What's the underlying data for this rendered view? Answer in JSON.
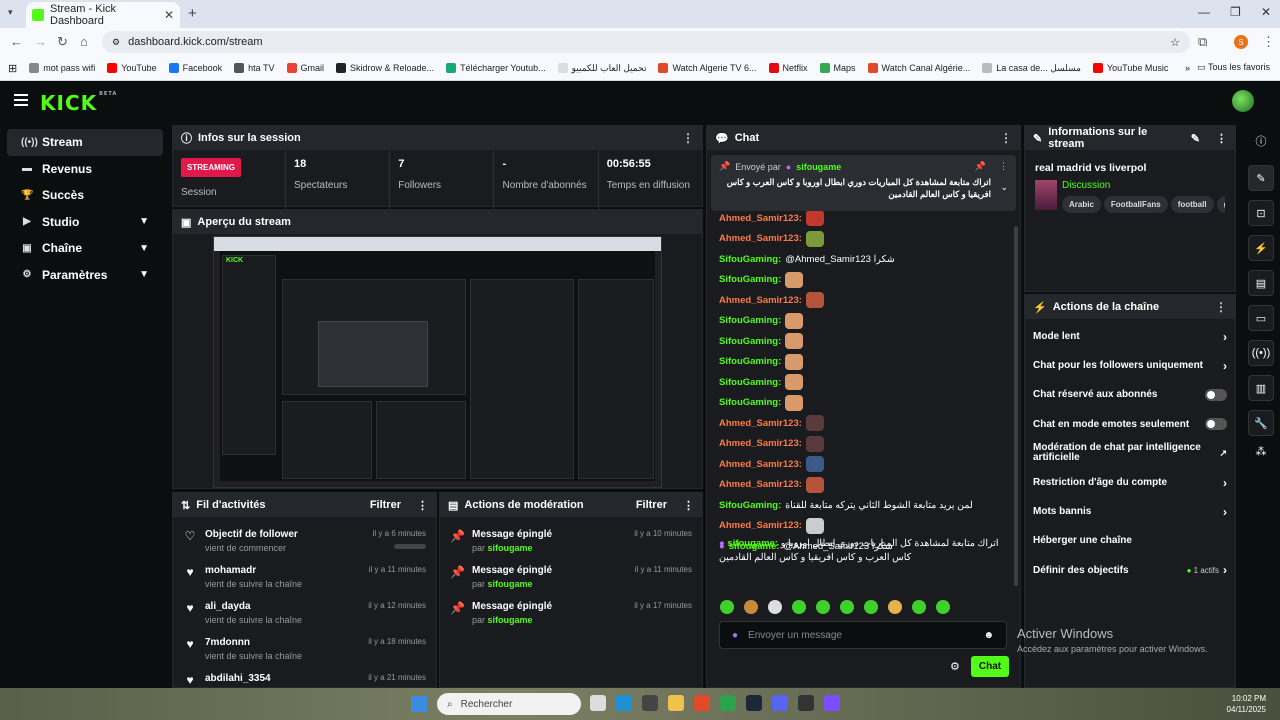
{
  "browser": {
    "tab_title": "Stream - Kick Dashboard",
    "url": "dashboard.kick.com/stream",
    "bookmarks": [
      "mot pass wifi",
      "YouTube",
      "Facebook",
      "hta TV",
      "Gmail",
      "Skidrow & Reloade...",
      "Télécharger Youtub...",
      "تحميل العاب للكمبيو",
      "Watch Algerie TV 6...",
      "Netflix",
      "Maps",
      "Watch Canal Algérie...",
      "La casa de... مسلسل",
      "YouTube Music"
    ],
    "all_bookmarks": "Tous les favoris",
    "profile_letter": "S"
  },
  "sidebar": {
    "items": [
      {
        "label": "Stream",
        "icon": "broadcast-icon"
      },
      {
        "label": "Revenus",
        "icon": "money-icon"
      },
      {
        "label": "Succès",
        "icon": "trophy-icon"
      },
      {
        "label": "Studio",
        "icon": "video-icon"
      },
      {
        "label": "Chaîne",
        "icon": "tv-icon"
      },
      {
        "label": "Paramètres",
        "icon": "gear-icon"
      }
    ]
  },
  "session": {
    "title": "Infos sur la session",
    "badge": "STREAMING",
    "badge_label": "Session",
    "viewers": "18",
    "viewers_label": "Spectateurs",
    "followers": "7",
    "followers_label": "Followers",
    "subs": "-",
    "subs_label": "Nombre d'abonnés",
    "time": "00:56:55",
    "time_label": "Temps en diffusion"
  },
  "preview": {
    "title": "Aperçu du stream"
  },
  "activity": {
    "title": "Fil d'activités",
    "filter": "Filtrer",
    "items": [
      {
        "title": "Objectif de follower",
        "sub": "vient de commencer",
        "time": "il y a 6 minutes"
      },
      {
        "title": "mohamadr",
        "sub": "vient de suivre la chaîne",
        "time": "il y a 11 minutes"
      },
      {
        "title": "ali_dayda",
        "sub": "vient de suivre la chaîne",
        "time": "il y a 12 minutes"
      },
      {
        "title": "7mdonnn",
        "sub": "vient de suivre la chaîne",
        "time": "il y a 18 minutes"
      },
      {
        "title": "abdilahi_3354",
        "sub": "",
        "time": "il y a 21 minutes"
      }
    ]
  },
  "moderation": {
    "title": "Actions de modération",
    "filter": "Filtrer",
    "items": [
      {
        "title": "Message épinglé",
        "by": "par",
        "user": "sifougame",
        "time": "il y a 10 minutes"
      },
      {
        "title": "Message épinglé",
        "by": "par",
        "user": "sifougame",
        "time": "il y a 11 minutes"
      },
      {
        "title": "Message épinglé",
        "by": "par",
        "user": "sifougame",
        "time": "il y a 17 minutes"
      }
    ]
  },
  "chat": {
    "title": "Chat",
    "pinned_by": "Envoyé par",
    "pinned_user": "sifougame",
    "pinned_text": "اتراك متابعة لمشاهدة كل المباريات دوري ابطال اوروبا و كاس العرب و كاس افريقيا و كاس العالم القادمين",
    "messages": [
      {
        "user": "Ahmed_Samir123:",
        "cls": "o",
        "text": ""
      },
      {
        "user": "Ahmed_Samir123:",
        "cls": "o",
        "text": ""
      },
      {
        "user": "SifouGaming:",
        "cls": "",
        "text": "@Ahmed_Samir123 شكرا"
      },
      {
        "user": "SifouGaming:",
        "cls": "",
        "text": ""
      },
      {
        "user": "Ahmed_Samir123:",
        "cls": "o",
        "text": ""
      },
      {
        "user": "SifouGaming:",
        "cls": "",
        "text": ""
      },
      {
        "user": "SifouGaming:",
        "cls": "",
        "text": ""
      },
      {
        "user": "SifouGaming:",
        "cls": "",
        "text": ""
      },
      {
        "user": "SifouGaming:",
        "cls": "",
        "text": ""
      },
      {
        "user": "SifouGaming:",
        "cls": "",
        "text": ""
      },
      {
        "user": "Ahmed_Samir123:",
        "cls": "o",
        "text": ""
      },
      {
        "user": "Ahmed_Samir123:",
        "cls": "o",
        "text": ""
      },
      {
        "user": "Ahmed_Samir123:",
        "cls": "o",
        "text": ""
      },
      {
        "user": "Ahmed_Samir123:",
        "cls": "o",
        "text": ""
      },
      {
        "user": "SifouGaming:",
        "cls": "",
        "text": "لمن يريد متابعة الشوط الثاني يتركه متابعة للقناة"
      },
      {
        "user": "Ahmed_Samir123:",
        "cls": "o",
        "text": ""
      },
      {
        "user": "sifougame:",
        "cls": "",
        "text": "@Ahmed_Samir123 شكرا"
      }
    ],
    "last_user": "sifougame:",
    "last_text": "اتراك متابعة لمشاهدة كل المباريات دوري ابطال اوروبا و كاس العرب و كاس افريقيا و كاس العالم القادمين",
    "input_placeholder": "Envoyer un message",
    "send": "Chat"
  },
  "stream_info": {
    "title": "Informations sur le stream",
    "stream_title": "real madrid vs liverpol",
    "category": "Discussion",
    "tags": [
      "Arabic",
      "FootballFans",
      "football",
      "g"
    ]
  },
  "channel_actions": {
    "title": "Actions de la chaîne",
    "rows": [
      {
        "label": "Mode lent",
        "type": "chev"
      },
      {
        "label": "Chat pour les followers uniquement",
        "type": "chev"
      },
      {
        "label": "Chat réservé aux abonnés",
        "type": "toggle"
      },
      {
        "label": "Chat en mode emotes seulement",
        "type": "toggle"
      },
      {
        "label": "Modération de chat par intelligence artificielle",
        "type": "ext"
      },
      {
        "label": "Restriction d'âge du compte",
        "type": "chev"
      },
      {
        "label": "Mots bannis",
        "type": "chev"
      },
      {
        "label": "Héberger une chaîne",
        "type": "none"
      },
      {
        "label": "Définir des objectifs",
        "type": "goals",
        "extra": "1 actifs"
      }
    ]
  },
  "watermark": {
    "line1": "Activer Windows",
    "line2": "Accédez aux paramètres pour activer Windows."
  },
  "taskbar": {
    "search": "Rechercher",
    "time": "10:02 PM",
    "date": "04/11/2025"
  }
}
